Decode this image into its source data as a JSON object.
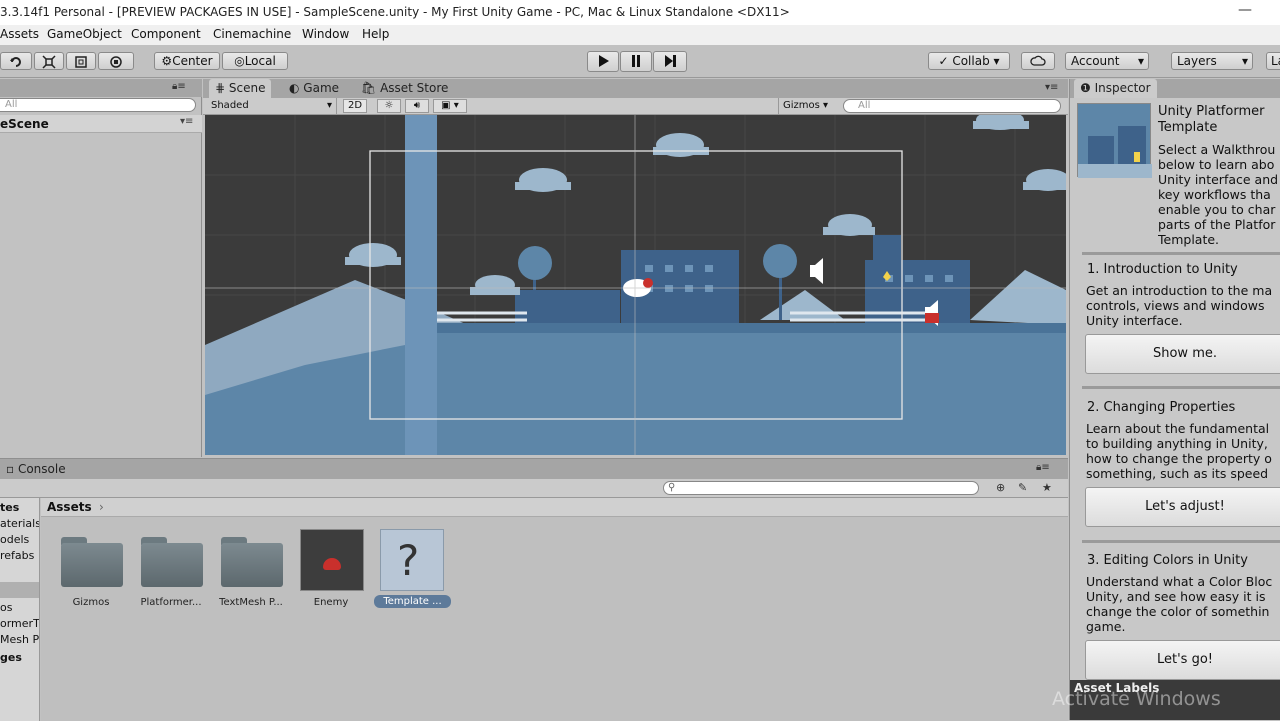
{
  "window": {
    "title": "3.3.14f1 Personal - [PREVIEW PACKAGES IN USE] - SampleScene.unity - My First Unity Game - PC, Mac & Linux Standalone <DX11>",
    "minimize_glyph": "—"
  },
  "menu": [
    "Assets",
    "GameObject",
    "Component",
    "Cinemachine",
    "Window",
    "Help"
  ],
  "toolbar": {
    "pivot_label": "Center",
    "space_label": "Local",
    "collab_label": "Collab",
    "account_label": "Account",
    "layers_label": "Layers",
    "layout_label": "La"
  },
  "hierarchy": {
    "search_placeholder": "All",
    "scene_name": "eScene"
  },
  "scene_view": {
    "tabs": [
      "Scene",
      "Game",
      "Asset Store"
    ],
    "shading_mode": "Shaded",
    "mode_2d": "2D",
    "gizmos_label": "Gizmos",
    "search_placeholder": "All"
  },
  "bottom": {
    "console_tab": "Console",
    "breadcrumb": "Assets",
    "tree_items": [
      "tes",
      "aterials",
      "odels",
      "refabs",
      "",
      "os",
      "ormerT",
      "Mesh P",
      "ges"
    ],
    "assets": [
      {
        "label": "Gizmos",
        "kind": "folder"
      },
      {
        "label": "Platformer...",
        "kind": "folder"
      },
      {
        "label": "TextMesh P...",
        "kind": "folder"
      },
      {
        "label": "Enemy",
        "kind": "prefab"
      },
      {
        "label": "Template ...",
        "kind": "unknown"
      }
    ],
    "unknown_glyph": "?"
  },
  "inspector": {
    "tab_label": "Inspector",
    "title_line1": "Unity Platformer",
    "title_line2": "Template",
    "intro": "Select a Walkthrou\nbelow to learn abo\nUnity interface and\nkey workflows tha\nenable you to char\nparts of the Platfor\nTemplate.",
    "sections": [
      {
        "heading": "1. Introduction to Unity",
        "body": "Get an introduction to the ma\ncontrols, views and windows\nUnity interface.",
        "button": "Show me."
      },
      {
        "heading": "2. Changing Properties",
        "body": "Learn about the fundamental\nto building anything in Unity,\nhow to change the property o\nsomething, such as its speed",
        "button": "Let's adjust!"
      },
      {
        "heading": "3. Editing Colors in Unity",
        "body": "Understand what a Color Bloc\nUnity, and see how easy it is\nchange the color of somethin\ngame.",
        "button": "Let's go!"
      }
    ],
    "asset_labels": "Asset Labels",
    "watermark": "Activate Windows"
  },
  "colors": {
    "scene_bg": "#3b3b3b",
    "level_blue": "#5d86a8",
    "building_blue": "#3e628a",
    "cloud": "#9db7cc",
    "hill_light": "#8fa9c0",
    "editor_grey": "#c2c2c2"
  }
}
